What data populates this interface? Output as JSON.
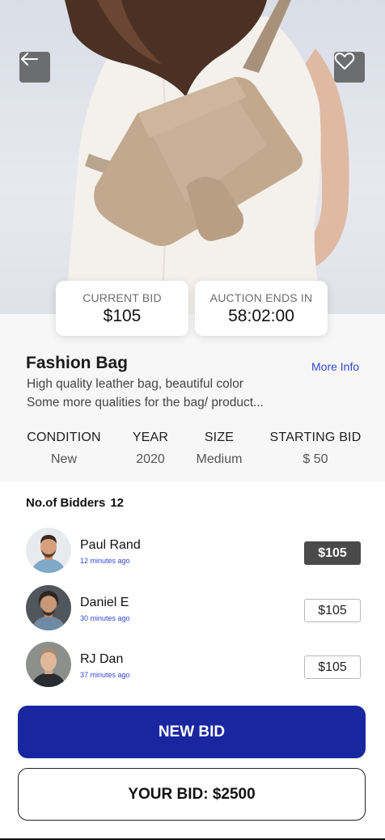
{
  "nav": {
    "back_icon": "arrow-left-icon",
    "favorite_icon": "heart-outline-icon"
  },
  "stats": {
    "current_bid_label": "CURRENT BID",
    "current_bid_value": "$105",
    "auction_ends_label": "AUCTION ENDS IN",
    "auction_ends_value": "58:02:00"
  },
  "product": {
    "title": "Fashion Bag",
    "more_info": "More Info",
    "description_line1": "High quality leather bag, beautiful color",
    "description_line2": "Some more qualities for the bag/ product...",
    "specs": [
      {
        "label": "CONDITION",
        "value": "New"
      },
      {
        "label": "YEAR",
        "value": "2020"
      },
      {
        "label": "SIZE",
        "value": "Medium"
      },
      {
        "label": "STARTING BID",
        "value": "$ 50"
      }
    ]
  },
  "bidders": {
    "label": "No.of Bidders",
    "count": "12",
    "list": [
      {
        "name": "Paul Rand",
        "time": "12 minutes ago",
        "amount": "$105"
      },
      {
        "name": "Daniel E",
        "time": "30 minutes ago",
        "amount": "$105"
      },
      {
        "name": "RJ Dan",
        "time": "37 minutes ago",
        "amount": "$105"
      }
    ]
  },
  "actions": {
    "new_bid": "NEW BID",
    "your_bid": "YOUR BID: $2500"
  },
  "colors": {
    "accent": "#1a25a0",
    "link": "#3346d6",
    "active_bid": "#4a4a4a"
  }
}
